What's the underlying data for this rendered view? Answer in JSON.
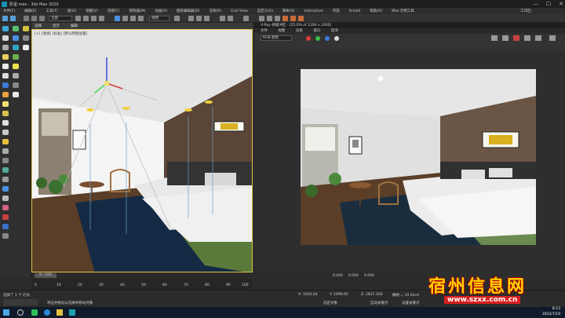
{
  "window": {
    "title": "卧室.max - 3ds Max 2020",
    "controls": [
      "—",
      "☐",
      "✕"
    ]
  },
  "menubar": {
    "items": [
      "文件(F)",
      "编辑(E)",
      "工具(T)",
      "组(G)",
      "视图(V)",
      "创建(C)",
      "修改器(M)",
      "动画(A)",
      "图形编辑器(D)",
      "渲染(R)",
      "Civil View",
      "自定义(U)",
      "脚本(S)",
      "Interactive",
      "内容",
      "Arnold",
      "帮助(H)",
      "Max 示例工具"
    ],
    "workspace": "工作区:"
  },
  "toolbar": {
    "selection_filter": "全部",
    "view_dropdown": "视图"
  },
  "viewport": {
    "tabs": [
      "选择",
      "显示",
      "编辑"
    ],
    "label": "[+] [透视] [标准] [默认明暗处理]",
    "frame_counter": "0 / 100"
  },
  "vray": {
    "title": "V-Ray 帧缓冲区 - [25.0% of 1200 x 2400]",
    "menu": [
      "文件",
      "视图",
      "渲染",
      "窗口",
      "选项"
    ],
    "channel": "RGB 颜色",
    "dot_colors": [
      "#e23b3b",
      "#3bbf4a",
      "#3b7be2"
    ],
    "status_values": [
      "0.000",
      "0.000",
      "0.000"
    ]
  },
  "timeline": {
    "ticks": [
      "0",
      "10",
      "20",
      "30",
      "40",
      "50",
      "60",
      "70",
      "80",
      "90",
      "100"
    ]
  },
  "status": {
    "selected": "选择了 1 个 灯光",
    "hint": "单击并拖动以选择并移动对象",
    "coords": [
      "X: 1050.04",
      "Y: 1999.65",
      "Z: 2837.356"
    ],
    "grid": "栅格 = 10.0mm",
    "autokey": "自动关键点",
    "setkey": "设置关键点",
    "filter": "选定对象"
  },
  "taskbar": {
    "time": "8:13",
    "date": "2022/7/19",
    "pinned": [
      "start",
      "search",
      "wechat",
      "edge",
      "explorer",
      "3dsmax"
    ]
  },
  "watermark": {
    "cn": "宿州信息网",
    "url": "www.szxx.com.cn"
  }
}
